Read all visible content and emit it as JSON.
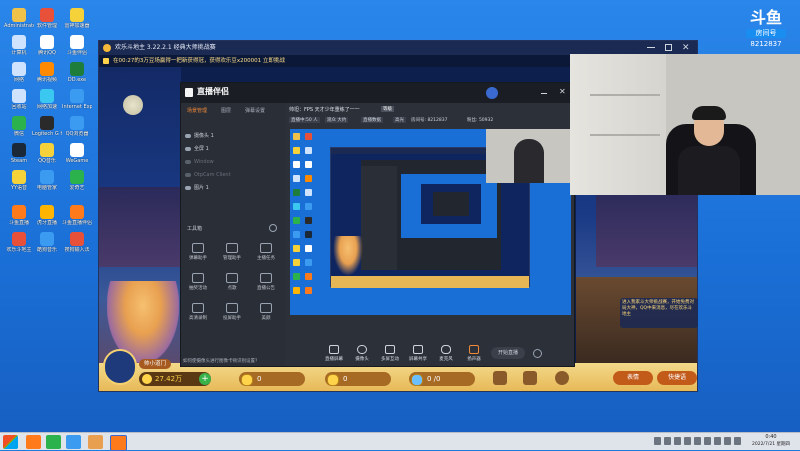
{
  "desktop": {
    "icons": [
      {
        "label": "Administrator",
        "icon": "user-folder-icon",
        "color": "#f0c24a"
      },
      {
        "label": "软件管理",
        "icon": "software-manager-icon",
        "color": "#e8503a"
      },
      {
        "label": "雷神加速器",
        "icon": "thunder-accelerator-icon",
        "color": "#f5d23a"
      },
      {
        "label": "计算机",
        "icon": "computer-icon",
        "color": "#cfe3ff"
      },
      {
        "label": "腾讯QQ",
        "icon": "qq-penguin-icon",
        "color": "#ffffff"
      },
      {
        "label": "斗鱼伴侣",
        "icon": "douyu-companion-icon",
        "color": "#ffffff"
      },
      {
        "label": "网络",
        "icon": "network-icon",
        "color": "#cfe3ff"
      },
      {
        "label": "腾讯视频",
        "icon": "tencent-video-icon",
        "color": "#ff8a00"
      },
      {
        "label": "DD.exe",
        "icon": "exe-icon",
        "color": "#1e7d3a"
      },
      {
        "label": "回收站",
        "icon": "recycle-bin-icon",
        "color": "#cfe3ff"
      },
      {
        "label": "网络加速",
        "icon": "speedup-icon",
        "color": "#3ac7f0"
      },
      {
        "label": "Internet Explorer",
        "icon": "ie-icon",
        "color": "#3a9bf0"
      },
      {
        "label": "微信",
        "icon": "wechat-icon",
        "color": "#2bb24c"
      },
      {
        "label": "Logitech G HUB",
        "icon": "logitech-icon",
        "color": "#2a2a2a"
      },
      {
        "label": "QQ浏览器",
        "icon": "qq-browser-icon",
        "color": "#3a9bf0"
      },
      {
        "label": "Steam",
        "icon": "steam-icon",
        "color": "#1b2838"
      },
      {
        "label": "QQ音乐",
        "icon": "qq-music-icon",
        "color": "#f5d23a"
      },
      {
        "label": "WeGame",
        "icon": "wegame-icon",
        "color": "#ffffff"
      },
      {
        "label": "YY语音",
        "icon": "yy-voice-icon",
        "color": "#f5d23a"
      },
      {
        "label": "电脑管家",
        "icon": "pc-manager-icon",
        "color": "#3a9bf0"
      },
      {
        "label": "爱奇艺",
        "icon": "iqiyi-icon",
        "color": "#2bb24c"
      },
      {
        "label": "斗鱼直播",
        "icon": "douyu-live-icon",
        "color": "#ff7a1a"
      },
      {
        "label": "虎牙直播",
        "icon": "huya-icon",
        "color": "#ffb400"
      },
      {
        "label": "斗鱼直播伴侣",
        "icon": "douyu-app-icon",
        "color": "#ff7a1a"
      },
      {
        "label": "欢乐斗地主",
        "icon": "landlord-game-icon",
        "color": "#e8503a"
      },
      {
        "label": "酷狗音乐",
        "icon": "kugou-icon",
        "color": "#3a9bf0"
      },
      {
        "label": "搜狗输入法",
        "icon": "sogou-icon",
        "color": "#e8503a"
      }
    ]
  },
  "douyu_overlay": {
    "brand": "斗鱼",
    "sub": "房间号",
    "room": "8212837"
  },
  "game": {
    "title": "欢乐斗地主 3.22.2.1 经典大师挑战赛",
    "marquee": "在00:27的3万豆场赢得一把新获得冠，获得欢乐豆x200001 立即挑战",
    "player_name": "帅小道门",
    "beans": "27.42万",
    "pills": [
      {
        "value": "0",
        "icon": "coin-icon"
      },
      {
        "value": "0",
        "icon": "diamond-icon"
      },
      {
        "value": "0 /0",
        "icon": "ticket-icon"
      }
    ],
    "bottom_buttons": [
      "表情",
      "快捷语"
    ],
    "chat_text": "进入我家斗大师挑战赛，开始免费对局大神，QQ中来消息，尽在欢乐斗地主"
  },
  "app": {
    "logo": "直播伴侣",
    "tabs": [
      "场景管理",
      "图层",
      "弹幕设置"
    ],
    "scenes": [
      {
        "label": "摄像头 1",
        "active": true
      },
      {
        "label": "全屏 1",
        "active": true
      },
      {
        "label": "Window",
        "active": false
      },
      {
        "label": "OtpCam Client",
        "active": false
      },
      {
        "label": "图片 1",
        "active": true
      }
    ],
    "tools_title": "工具箱",
    "tools": [
      "弹幕助手",
      "管理助手",
      "主播任务",
      "抽奖活动",
      "点歌",
      "直播公告",
      "高清录制",
      "投屏助手",
      "美颜"
    ],
    "header": {
      "title": "帅坦：FPS 天才少年重练了一一",
      "level": "等级",
      "stats": [
        "直播中:50 人",
        "观众 大约",
        "直播数据",
        "高光",
        "房间号: 8212837",
        "粉丝: 50932"
      ],
      "room": "8212837",
      "fans": "50932"
    },
    "bottom_buttons": [
      "直播屏幕",
      "摄像头",
      "多屏互动",
      "屏幕共享",
      "麦克风",
      "扬声器"
    ],
    "start_button": "开始直播",
    "camera_prompt": "如何使摄像头进行图像卡顿识别设置？"
  },
  "taskbar": {
    "time": "0:40",
    "date": "2022/7/21 星期四"
  }
}
